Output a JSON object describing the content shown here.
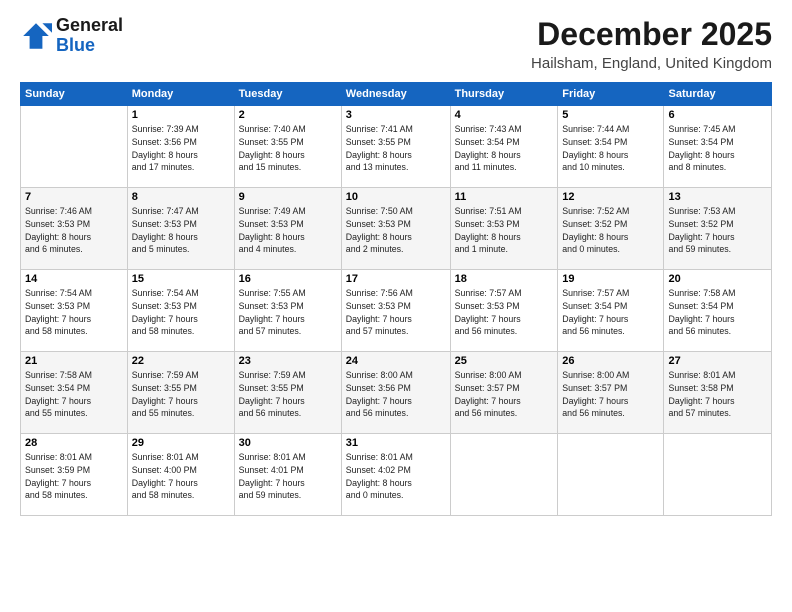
{
  "logo": {
    "line1": "General",
    "line2": "Blue"
  },
  "header": {
    "month": "December 2025",
    "location": "Hailsham, England, United Kingdom"
  },
  "days_of_week": [
    "Sunday",
    "Monday",
    "Tuesday",
    "Wednesday",
    "Thursday",
    "Friday",
    "Saturday"
  ],
  "weeks": [
    [
      {
        "day": "",
        "info": ""
      },
      {
        "day": "1",
        "info": "Sunrise: 7:39 AM\nSunset: 3:56 PM\nDaylight: 8 hours\nand 17 minutes."
      },
      {
        "day": "2",
        "info": "Sunrise: 7:40 AM\nSunset: 3:55 PM\nDaylight: 8 hours\nand 15 minutes."
      },
      {
        "day": "3",
        "info": "Sunrise: 7:41 AM\nSunset: 3:55 PM\nDaylight: 8 hours\nand 13 minutes."
      },
      {
        "day": "4",
        "info": "Sunrise: 7:43 AM\nSunset: 3:54 PM\nDaylight: 8 hours\nand 11 minutes."
      },
      {
        "day": "5",
        "info": "Sunrise: 7:44 AM\nSunset: 3:54 PM\nDaylight: 8 hours\nand 10 minutes."
      },
      {
        "day": "6",
        "info": "Sunrise: 7:45 AM\nSunset: 3:54 PM\nDaylight: 8 hours\nand 8 minutes."
      }
    ],
    [
      {
        "day": "7",
        "info": "Sunrise: 7:46 AM\nSunset: 3:53 PM\nDaylight: 8 hours\nand 6 minutes."
      },
      {
        "day": "8",
        "info": "Sunrise: 7:47 AM\nSunset: 3:53 PM\nDaylight: 8 hours\nand 5 minutes."
      },
      {
        "day": "9",
        "info": "Sunrise: 7:49 AM\nSunset: 3:53 PM\nDaylight: 8 hours\nand 4 minutes."
      },
      {
        "day": "10",
        "info": "Sunrise: 7:50 AM\nSunset: 3:53 PM\nDaylight: 8 hours\nand 2 minutes."
      },
      {
        "day": "11",
        "info": "Sunrise: 7:51 AM\nSunset: 3:53 PM\nDaylight: 8 hours\nand 1 minute."
      },
      {
        "day": "12",
        "info": "Sunrise: 7:52 AM\nSunset: 3:52 PM\nDaylight: 8 hours\nand 0 minutes."
      },
      {
        "day": "13",
        "info": "Sunrise: 7:53 AM\nSunset: 3:52 PM\nDaylight: 7 hours\nand 59 minutes."
      }
    ],
    [
      {
        "day": "14",
        "info": "Sunrise: 7:54 AM\nSunset: 3:53 PM\nDaylight: 7 hours\nand 58 minutes."
      },
      {
        "day": "15",
        "info": "Sunrise: 7:54 AM\nSunset: 3:53 PM\nDaylight: 7 hours\nand 58 minutes."
      },
      {
        "day": "16",
        "info": "Sunrise: 7:55 AM\nSunset: 3:53 PM\nDaylight: 7 hours\nand 57 minutes."
      },
      {
        "day": "17",
        "info": "Sunrise: 7:56 AM\nSunset: 3:53 PM\nDaylight: 7 hours\nand 57 minutes."
      },
      {
        "day": "18",
        "info": "Sunrise: 7:57 AM\nSunset: 3:53 PM\nDaylight: 7 hours\nand 56 minutes."
      },
      {
        "day": "19",
        "info": "Sunrise: 7:57 AM\nSunset: 3:54 PM\nDaylight: 7 hours\nand 56 minutes."
      },
      {
        "day": "20",
        "info": "Sunrise: 7:58 AM\nSunset: 3:54 PM\nDaylight: 7 hours\nand 56 minutes."
      }
    ],
    [
      {
        "day": "21",
        "info": "Sunrise: 7:58 AM\nSunset: 3:54 PM\nDaylight: 7 hours\nand 55 minutes."
      },
      {
        "day": "22",
        "info": "Sunrise: 7:59 AM\nSunset: 3:55 PM\nDaylight: 7 hours\nand 55 minutes."
      },
      {
        "day": "23",
        "info": "Sunrise: 7:59 AM\nSunset: 3:55 PM\nDaylight: 7 hours\nand 56 minutes."
      },
      {
        "day": "24",
        "info": "Sunrise: 8:00 AM\nSunset: 3:56 PM\nDaylight: 7 hours\nand 56 minutes."
      },
      {
        "day": "25",
        "info": "Sunrise: 8:00 AM\nSunset: 3:57 PM\nDaylight: 7 hours\nand 56 minutes."
      },
      {
        "day": "26",
        "info": "Sunrise: 8:00 AM\nSunset: 3:57 PM\nDaylight: 7 hours\nand 56 minutes."
      },
      {
        "day": "27",
        "info": "Sunrise: 8:01 AM\nSunset: 3:58 PM\nDaylight: 7 hours\nand 57 minutes."
      }
    ],
    [
      {
        "day": "28",
        "info": "Sunrise: 8:01 AM\nSunset: 3:59 PM\nDaylight: 7 hours\nand 58 minutes."
      },
      {
        "day": "29",
        "info": "Sunrise: 8:01 AM\nSunset: 4:00 PM\nDaylight: 7 hours\nand 58 minutes."
      },
      {
        "day": "30",
        "info": "Sunrise: 8:01 AM\nSunset: 4:01 PM\nDaylight: 7 hours\nand 59 minutes."
      },
      {
        "day": "31",
        "info": "Sunrise: 8:01 AM\nSunset: 4:02 PM\nDaylight: 8 hours\nand 0 minutes."
      },
      {
        "day": "",
        "info": ""
      },
      {
        "day": "",
        "info": ""
      },
      {
        "day": "",
        "info": ""
      }
    ]
  ]
}
